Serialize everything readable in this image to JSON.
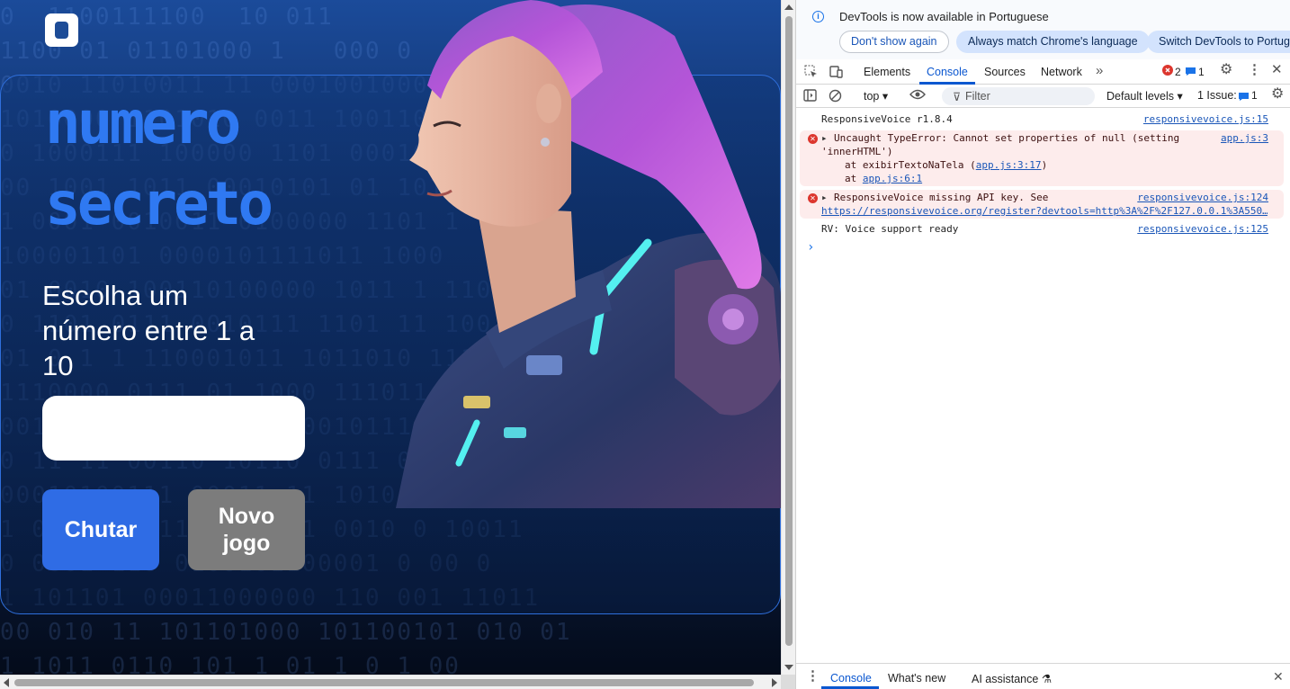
{
  "page": {
    "hero_line1": "numero",
    "hero_line2": "secreto",
    "prompt": "Escolha um número entre 1 a 10",
    "input_value": "",
    "chutar_label": "Chutar",
    "novo_line1": "Novo",
    "novo_line2": "jogo",
    "matrix_lines": [
      "0  1100111100  10 011",
      "1100 01 01101000 1   000 0",
      "0010 11010011 11 00010010001 1",
      "1010000 1101010 0011 1001100 0",
      "0 1000111 100000 1101 0001011 0",
      "00 1001 1011 00010101 01 101",
      "1 0001 0010011 0100000 1101 1 1",
      "100001101 0000101111011 1000",
      "01 0010 100110100000 1011 1 1101",
      "0 1101 0111 0010111 1101 11 100",
      "01 0 1 1 110001011 1011010 11100",
      "1110000 0111 01 1000 111011 0010",
      "001 00 10001000 10000101111 00 1",
      "0 11 11 00110 10110 0111 01 0010",
      "00010100111 00011 11 1010 00 00 0",
      "1 0000 0011100000111 0010 0 10011",
      "0 0001 110 0100101100001 0 00 0",
      "1 101101 00011000000 110 001 11011",
      "00 010 11 101101000 101100101 010 01",
      "1 1011 0110 101 1 01 1 0 1 00"
    ]
  },
  "devtools": {
    "info": {
      "message": "DevTools is now available in Portuguese",
      "btn_dont_show": "Don't show again",
      "btn_match": "Always match Chrome's language",
      "btn_switch": "Switch DevTools to Portuguese"
    },
    "tabs": {
      "elements": "Elements",
      "console": "Console",
      "sources": "Sources",
      "network": "Network",
      "more": "»",
      "error_count": "2",
      "message_count": "1"
    },
    "toolbar": {
      "context": "top",
      "filter_placeholder": "Filter",
      "levels": "Default levels",
      "issues_label": "1 Issue:",
      "issues_count": "1"
    },
    "console": {
      "messages": [
        {
          "text": "ResponsiveVoice r1.8.4",
          "source": "responsivevoice.js:15"
        },
        {
          "line1": "Uncaught TypeError: Cannot set properties of null (setting",
          "line2": "'innerHTML')",
          "line3_pre": "at exibirTextoNaTela (",
          "line3_link": "app.js:3:17",
          "line3_post": ")",
          "line4_pre": "at ",
          "line4_link": "app.js:6:1",
          "source": "app.js:3"
        },
        {
          "line1": "ResponsiveVoice missing API key. See",
          "line2_link": "https://responsivevoice.org/register?devtools=http%3A%2F%2F127.0.0.1%3A550…",
          "source": "responsivevoice.js:124"
        },
        {
          "text": "RV: Voice support ready",
          "source": "responsivevoice.js:125"
        }
      ],
      "prompt_symbol": "›"
    },
    "drawer": {
      "console": "Console",
      "whats_new": "What's new",
      "ai_assistance": "AI assistance"
    }
  },
  "colors": {
    "hero": "#2f79f2",
    "chutar_bg": "#2f6ce5",
    "novo_bg": "#7c7c7c",
    "devtools_accent": "#0b57d0",
    "error_bg": "#fdecec",
    "error_icon": "#dc362e"
  }
}
